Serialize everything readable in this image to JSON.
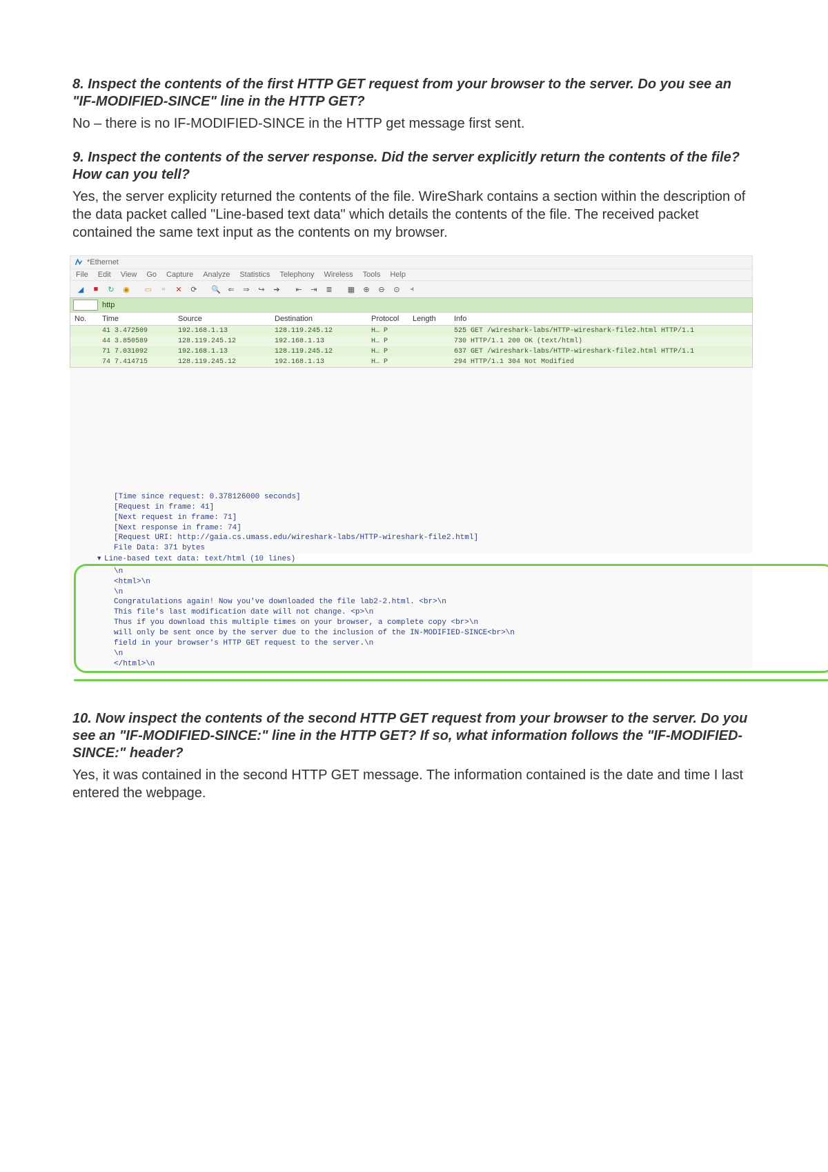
{
  "q8": {
    "question": "8. Inspect the contents of the first HTTP GET request from your browser to the server. Do you see an \"IF-MODIFIED-SINCE\" line in the HTTP GET?",
    "answer": "No – there is no IF-MODIFIED-SINCE in the HTTP get message first sent."
  },
  "q9": {
    "question": "9. Inspect the contents of the server response. Did the server explicitly return the contents of the file? How can you tell?",
    "answer": "Yes, the server explicity returned the contents of the file. WireShark contains a section within the description of the data packet called \"Line-based text data\" which details the contents of the file. The received packet contained the same text input as the contents on my browser."
  },
  "q10": {
    "question": "10. Now inspect the contents of the second HTTP GET request from your browser to the server. Do you see an \"IF-MODIFIED-SINCE:\" line in the HTTP GET? If so, what information follows the \"IF-MODIFIED-SINCE:\" header?",
    "answer": "Yes, it was contained in the second HTTP GET message. The information contained is the date and time I last entered the webpage."
  },
  "wireshark": {
    "title": "*Ethernet",
    "menu": [
      "File",
      "Edit",
      "View",
      "Go",
      "Capture",
      "Analyze",
      "Statistics",
      "Telephony",
      "Wireless",
      "Tools",
      "Help"
    ],
    "filter_label": "http",
    "headers": [
      "No.",
      "Time",
      "Source",
      "Destination",
      "Protocol",
      "Length",
      "Info"
    ],
    "rows": [
      {
        "no": "",
        "time": "41 3.472509",
        "src": "192.168.1.13",
        "dst": "128.119.245.12",
        "proto": "H… P",
        "len": "",
        "info": "525 GET /wireshark-labs/HTTP-wireshark-file2.html HTTP/1.1"
      },
      {
        "no": "",
        "time": "44 3.850589",
        "src": "128.119.245.12",
        "dst": "192.168.1.13",
        "proto": "H… P",
        "len": "",
        "info": "730 HTTP/1.1 200 OK  (text/html)"
      },
      {
        "no": "",
        "time": "71 7.031092",
        "src": "192.168.1.13",
        "dst": "128.119.245.12",
        "proto": "H… P",
        "len": "",
        "info": "637 GET /wireshark-labs/HTTP-wireshark-file2.html HTTP/1.1"
      },
      {
        "no": "",
        "time": "74 7.414715",
        "src": "128.119.245.12",
        "dst": "192.168.1.13",
        "proto": "H… P",
        "len": "",
        "info": "294 HTTP/1.1 304 Not Modified"
      }
    ],
    "detail_top": [
      "[Time since request: 0.378126000 seconds]",
      "[Request in frame: 41]",
      "[Next request in frame: 71]",
      "[Next response in frame: 74]",
      "[Request URI: http://gaia.cs.umass.edu/wireshark-labs/HTTP-wireshark-file2.html]",
      "File Data: 371 bytes"
    ],
    "line_header": "Line-based text data: text/html (10 lines)",
    "body_lines": [
      "\\n",
      "<html>\\n",
      "\\n",
      "Congratulations again!  Now you've downloaded the file lab2-2.html. <br>\\n",
      "This file's last modification date will not change.  <p>\\n",
      "Thus  if you download this multiple times on your browser, a complete copy <br>\\n",
      "will only be sent once by the server due to the inclusion of the IN-MODIFIED-SINCE<br>\\n",
      "field in your browser's HTTP GET request to the server.\\n",
      "\\n",
      "</html>\\n"
    ]
  }
}
